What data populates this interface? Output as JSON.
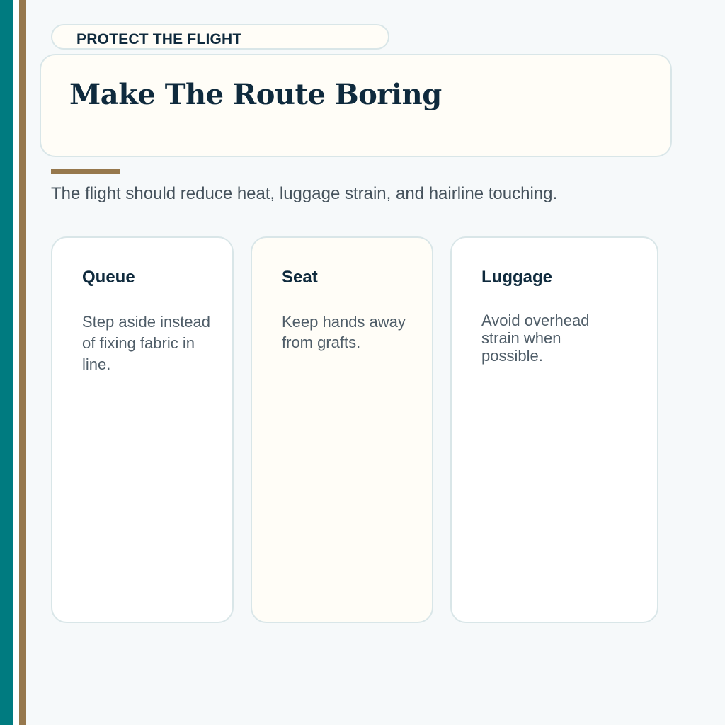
{
  "eyebrow": "PROTECT THE FLIGHT",
  "title": "Make The Route Boring",
  "subtitle": "The flight should reduce heat, luggage strain, and hairline touching.",
  "cards": [
    {
      "title": "Queue",
      "body": "Step aside instead of fixing fabric in line."
    },
    {
      "title": "Seat",
      "body": "Keep hands away from grafts."
    },
    {
      "title": "Luggage",
      "body": "Avoid overhead strain when possible."
    }
  ],
  "colors": {
    "teal": "#007b80",
    "brown": "#96784d",
    "navy": "#0f2a3d",
    "cream": "#fffdf7",
    "background": "#f6f9fa",
    "border": "#d9e6e8"
  }
}
